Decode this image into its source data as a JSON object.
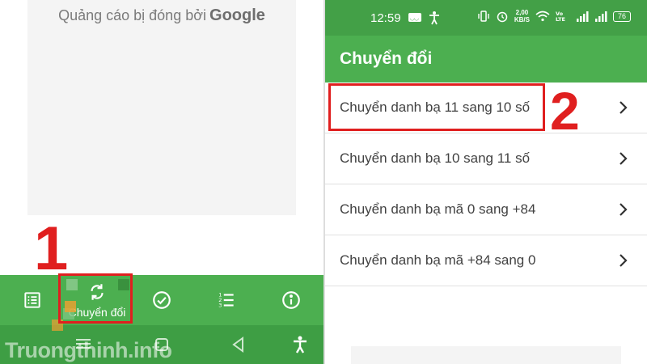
{
  "left_screen": {
    "ad": {
      "text": "Quảng cáo bị đóng bởi",
      "brand": "Google"
    },
    "bottom_nav": [
      {
        "icon": "list-icon",
        "label": ""
      },
      {
        "icon": "convert-icon",
        "label": "Chuyển đổi"
      },
      {
        "icon": "check-circle-icon",
        "label": ""
      },
      {
        "icon": "numbered-list-icon",
        "label": ""
      },
      {
        "icon": "info-icon",
        "label": ""
      }
    ],
    "system_nav": [
      "menu-icon",
      "home-icon",
      "back-icon",
      "accessibility-icon"
    ]
  },
  "right_screen": {
    "status_bar": {
      "time": "12:59",
      "speed_value": "2,00",
      "speed_unit": "KB/S",
      "battery": "76"
    },
    "app_bar": {
      "title": "Chuyển đổi"
    },
    "list": [
      {
        "label": "Chuyển danh bạ 11 sang 10 số"
      },
      {
        "label": "Chuyển danh bạ 10 sang 11 số"
      },
      {
        "label": "Chuyển danh bạ mã 0 sang +84"
      },
      {
        "label": "Chuyển danh bạ mã +84 sang 0"
      }
    ]
  },
  "annotations": {
    "step1": "1",
    "step2": "2"
  },
  "watermark": {
    "text": "Truongthinh.info"
  },
  "colors": {
    "primary_green": "#4caf50",
    "status_green": "#43a047",
    "highlight_red": "#e01f1f"
  }
}
